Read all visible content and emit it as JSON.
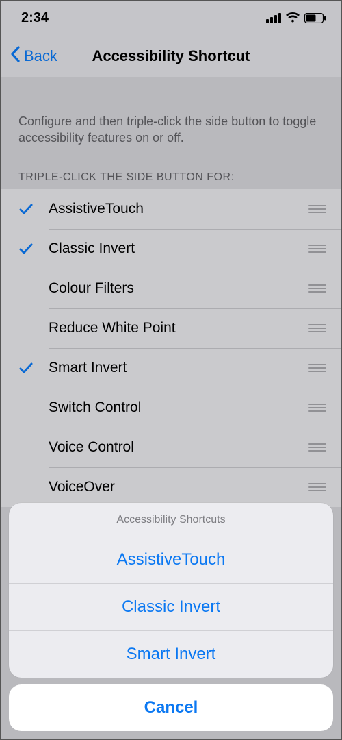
{
  "status": {
    "time": "2:34"
  },
  "nav": {
    "back": "Back",
    "title": "Accessibility Shortcut"
  },
  "description": "Configure and then triple-click the side button to toggle accessibility features on or off.",
  "section_header": "TRIPLE-CLICK THE SIDE BUTTON FOR:",
  "items": [
    {
      "label": "AssistiveTouch",
      "checked": true
    },
    {
      "label": "Classic Invert",
      "checked": true
    },
    {
      "label": "Colour Filters",
      "checked": false
    },
    {
      "label": "Reduce White Point",
      "checked": false
    },
    {
      "label": "Smart Invert",
      "checked": true
    },
    {
      "label": "Switch Control",
      "checked": false
    },
    {
      "label": "Voice Control",
      "checked": false
    },
    {
      "label": "VoiceOver",
      "checked": false
    }
  ],
  "sheet": {
    "title": "Accessibility Shortcuts",
    "options": [
      "AssistiveTouch",
      "Classic Invert",
      "Smart Invert"
    ],
    "cancel": "Cancel"
  }
}
